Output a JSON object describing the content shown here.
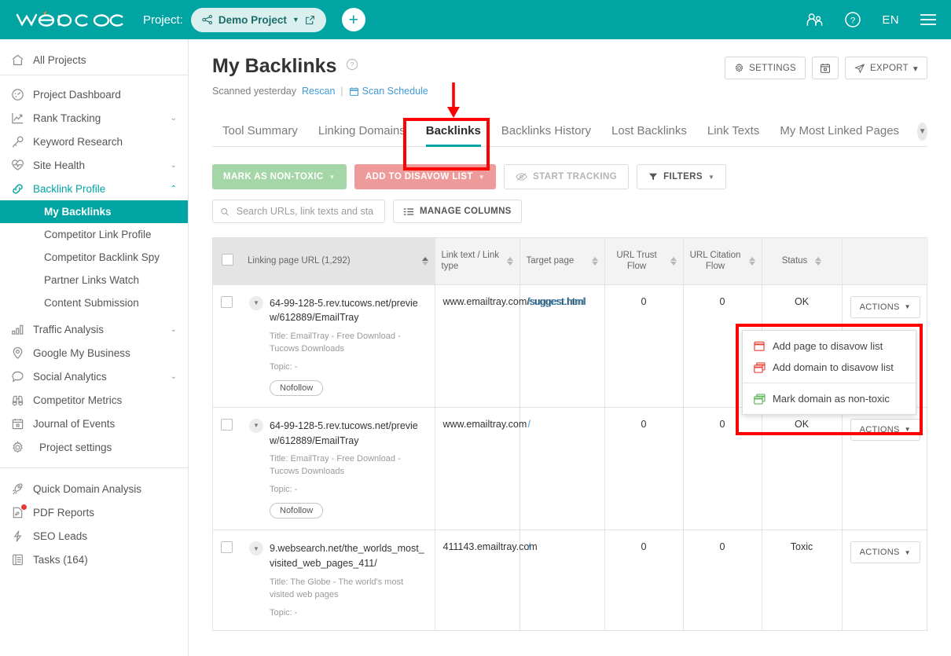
{
  "topbar": {
    "logo_text": "web ceo",
    "project_label": "Project:",
    "project_name": "Demo Project",
    "add_button": "+",
    "lang": "EN",
    "icons": [
      "users-icon",
      "help-icon",
      "hamburger-icon"
    ]
  },
  "sidebar": {
    "top": {
      "label": "All Projects",
      "icon": "home-icon"
    },
    "items": [
      {
        "label": "Project Dashboard",
        "icon": "dashboard-icon",
        "chevron": ""
      },
      {
        "label": "Rank Tracking",
        "icon": "chart-up-icon",
        "chevron": "⌄"
      },
      {
        "label": "Keyword Research",
        "icon": "key-icon",
        "chevron": ""
      },
      {
        "label": "Site Health",
        "icon": "heartbeat-icon",
        "chevron": "⌄"
      },
      {
        "label": "Backlink Profile",
        "icon": "link-icon",
        "chevron": "⌃",
        "active": true
      }
    ],
    "sub_items": [
      {
        "label": "My Backlinks",
        "selected": true
      },
      {
        "label": "Competitor Link Profile",
        "selected": false
      },
      {
        "label": "Competitor Backlink Spy",
        "selected": false
      },
      {
        "label": "Partner Links Watch",
        "selected": false
      },
      {
        "label": "Content Submission",
        "selected": false
      }
    ],
    "items2": [
      {
        "label": "Traffic Analysis",
        "icon": "bars-icon",
        "chevron": "⌄"
      },
      {
        "label": "Google My Business",
        "icon": "pin-icon",
        "chevron": ""
      },
      {
        "label": "Social Analytics",
        "icon": "chat-icon",
        "chevron": "⌄"
      },
      {
        "label": "Competitor Metrics",
        "icon": "binoculars-icon",
        "chevron": ""
      },
      {
        "label": "Journal of Events",
        "icon": "calendar-icon",
        "chevron": ""
      },
      {
        "label": "Project settings",
        "icon": "gear-icon",
        "chevron": ""
      }
    ],
    "items3": [
      {
        "label": "Quick Domain Analysis",
        "icon": "rocket-icon",
        "chevron": ""
      },
      {
        "label": "PDF Reports",
        "icon": "pdf-icon",
        "chevron": "",
        "badge": true
      },
      {
        "label": "SEO Leads",
        "icon": "bolt-icon",
        "chevron": ""
      },
      {
        "label": "Tasks (164)",
        "icon": "list-icon",
        "chevron": ""
      }
    ]
  },
  "page": {
    "title": "My Backlinks",
    "help_icon": "help-circle-icon",
    "scanned_text": "Scanned yesterday",
    "rescan_link": "Rescan",
    "separator": "|",
    "scan_schedule": "Scan Schedule",
    "head_buttons": [
      {
        "label": "SETTINGS",
        "icon": "gear-icon"
      },
      {
        "label": "",
        "icon": "calendar-icon"
      },
      {
        "label": "EXPORT",
        "icon": "send-icon",
        "caret": "▾"
      }
    ]
  },
  "tabs": [
    {
      "label": "Tool Summary",
      "selected": false
    },
    {
      "label": "Linking Domains",
      "selected": false
    },
    {
      "label": "Backlinks",
      "selected": true
    },
    {
      "label": "Backlinks History",
      "selected": false
    },
    {
      "label": "Lost Backlinks",
      "selected": false
    },
    {
      "label": "Link Texts",
      "selected": false
    },
    {
      "label": "My Most Linked Pages",
      "selected": false
    }
  ],
  "toolbar": {
    "mark_non_toxic": "MARK AS NON-TOXIC",
    "add_disavow": "ADD TO DISAVOW LIST",
    "start_tracking": "START TRACKING",
    "filters": "FILTERS",
    "search_placeholder": "Search URLs, link texts and sta",
    "search_value": "",
    "manage_columns": "MANAGE COLUMNS"
  },
  "table": {
    "columns": [
      {
        "label": "Linking page URL (1,292)",
        "sorted": true,
        "align": "l"
      },
      {
        "label": "Link text / Link type",
        "sorted": false,
        "align": "l"
      },
      {
        "label": "Target page",
        "sorted": false,
        "align": "l"
      },
      {
        "label": "URL Trust Flow",
        "sorted": false,
        "align": "c"
      },
      {
        "label": "URL Citation Flow",
        "sorted": false,
        "align": "c"
      },
      {
        "label": "Status",
        "sorted": false,
        "align": "c"
      }
    ],
    "rows": [
      {
        "url": "64-99-128-5.rev.tucows.net/preview/612889/EmailTray",
        "title": "Title: EmailTray - Free Download - Tucows Downloads",
        "topic": "Topic: -",
        "tag": "Nofollow",
        "link_text": "www.emailtray.com/suggest.html",
        "target": "/suggest.html",
        "trust_flow": "0",
        "citation_flow": "0",
        "status": "OK",
        "status_kind": "ok",
        "actions": "ACTIONS"
      },
      {
        "url": "64-99-128-5.rev.tucows.net/preview/612889/EmailTray",
        "title": "Title: EmailTray - Free Download - Tucows Downloads",
        "topic": "Topic: -",
        "tag": "Nofollow",
        "link_text": "www.emailtray.com",
        "target": "/",
        "trust_flow": "0",
        "citation_flow": "0",
        "status": "OK",
        "status_kind": "ok",
        "actions": "ACTIONS"
      },
      {
        "url": "9.websearch.net/the_worlds_most_visited_web_pages_411/",
        "title": "Title: The Globe - The world's most visited web pages",
        "topic": "Topic: -",
        "tag": "",
        "link_text": "411143.emailtray.com",
        "target": "/",
        "trust_flow": "0",
        "citation_flow": "0",
        "status": "Toxic",
        "status_kind": "toxic",
        "actions": "ACTIONS"
      }
    ]
  },
  "dropdown": {
    "items": [
      {
        "label": "Add page to disavow list",
        "icon": "disavow-page-icon",
        "color": "#e8483f"
      },
      {
        "label": "Add domain to disavow list",
        "icon": "disavow-domain-icon",
        "color": "#e8483f"
      }
    ],
    "items2": [
      {
        "label": "Mark domain as non-toxic",
        "icon": "non-toxic-domain-icon",
        "color": "#61b561"
      }
    ]
  },
  "annotations": {
    "arrow_color": "#ff0000",
    "highlight_color": "#ff0000"
  },
  "colors": {
    "brand": "#00a5a3",
    "link": "#3d9ad6",
    "ok": "#61b561",
    "toxic": "#e8483f"
  }
}
